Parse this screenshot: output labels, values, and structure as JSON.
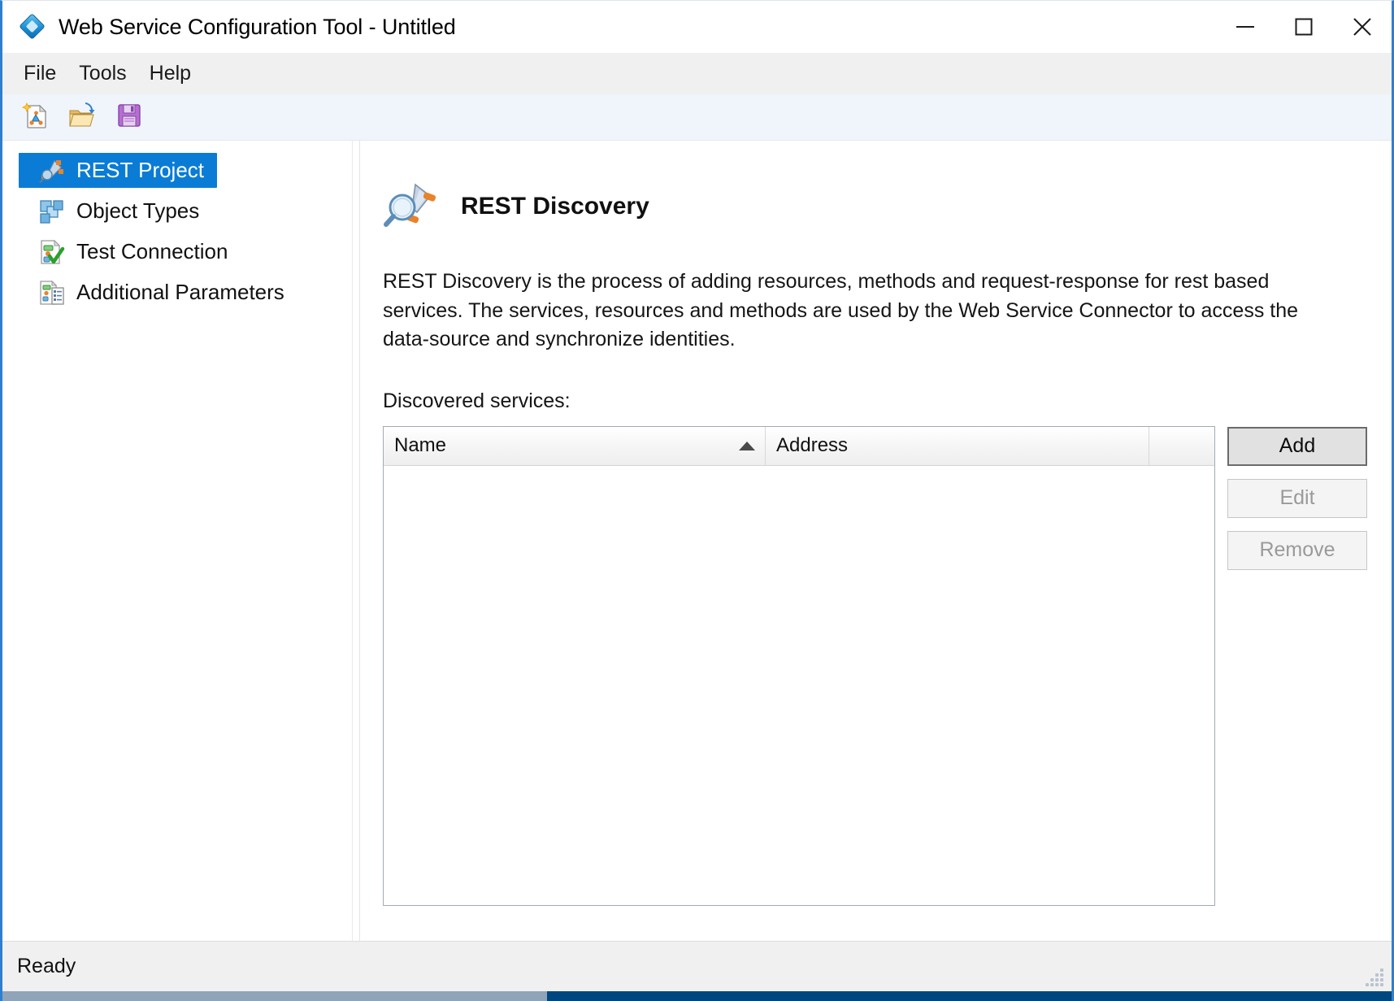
{
  "window": {
    "title": "Web Service Configuration Tool - Untitled",
    "app_icon": "diamond-app-icon",
    "controls": {
      "minimize": "minimize-icon",
      "maximize": "maximize-icon",
      "close": "close-icon"
    },
    "accent_color": "#2f7fd0"
  },
  "menubar": {
    "items": [
      {
        "label": "File"
      },
      {
        "label": "Tools"
      },
      {
        "label": "Help"
      }
    ]
  },
  "toolbar": {
    "buttons": [
      {
        "name": "new-project-icon",
        "tooltip": "New"
      },
      {
        "name": "open-project-icon",
        "tooltip": "Open"
      },
      {
        "name": "save-project-icon",
        "tooltip": "Save"
      }
    ]
  },
  "sidebar": {
    "items": [
      {
        "label": "REST Project",
        "icon": "rest-project-icon",
        "selected": true
      },
      {
        "label": "Object Types",
        "icon": "object-types-icon",
        "selected": false
      },
      {
        "label": "Test Connection",
        "icon": "test-connection-icon",
        "selected": false
      },
      {
        "label": "Additional Parameters",
        "icon": "additional-parameters-icon",
        "selected": false
      }
    ],
    "selected_color": "#0a7cd6"
  },
  "content": {
    "page_icon": "rest-discovery-icon",
    "title": "REST Discovery",
    "description": "REST Discovery is the process of adding resources, methods and request-response for rest based services. The services, resources and methods are used by the Web Service Connector to access the data-source and synchronize identities.",
    "list_label": "Discovered services:",
    "table": {
      "columns": [
        {
          "label": "Name",
          "sorted": "ascending",
          "sort_icon": "sort-ascending-icon"
        },
        {
          "label": "Address",
          "sorted": "none"
        },
        {
          "label": "",
          "sorted": "none"
        }
      ],
      "rows": []
    },
    "buttons": [
      {
        "label": "Add",
        "enabled": true
      },
      {
        "label": "Edit",
        "enabled": false
      },
      {
        "label": "Remove",
        "enabled": false
      }
    ]
  },
  "statusbar": {
    "text": "Ready",
    "grip": "resize-grip-icon"
  }
}
